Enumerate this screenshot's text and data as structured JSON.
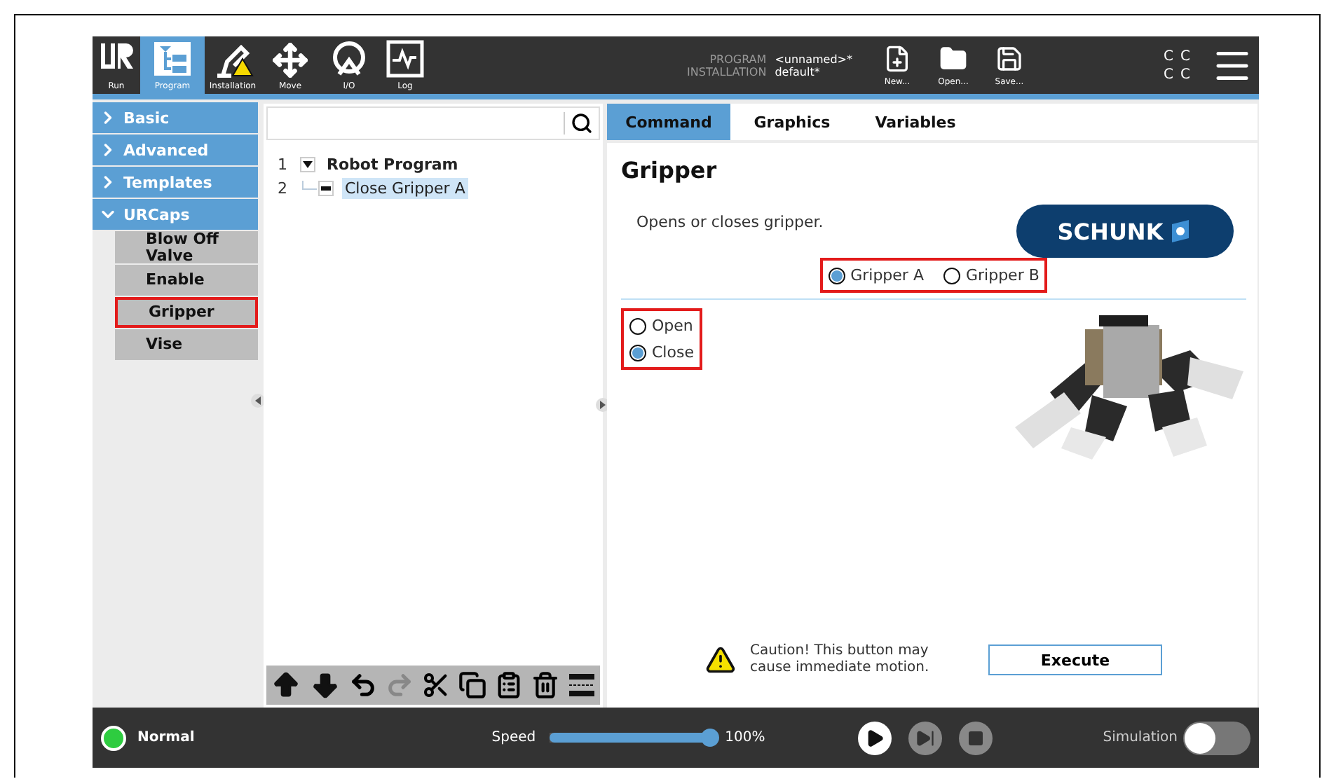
{
  "header": {
    "tabs": [
      {
        "label": "Run",
        "kind": "run",
        "selected": false
      },
      {
        "label": "Program",
        "kind": "program",
        "selected": true
      },
      {
        "label": "Installation",
        "kind": "installation",
        "selected": false
      },
      {
        "label": "Move",
        "kind": "move",
        "selected": false
      },
      {
        "label": "I/O",
        "kind": "io",
        "selected": false
      },
      {
        "label": "Log",
        "kind": "log",
        "selected": false
      }
    ],
    "program_label": "PROGRAM",
    "program_name": "<unnamed>*",
    "installation_label": "INSTALLATION",
    "installation_name": "default*",
    "file_buttons": [
      {
        "label": "New...",
        "kind": "new"
      },
      {
        "label": "Open...",
        "kind": "open"
      },
      {
        "label": "Save...",
        "kind": "save"
      }
    ],
    "status_letters": [
      "C",
      "C",
      "C",
      "C"
    ]
  },
  "sidebar": {
    "groups": [
      {
        "label": "Basic",
        "expanded": false
      },
      {
        "label": "Advanced",
        "expanded": false
      },
      {
        "label": "Templates",
        "expanded": false
      },
      {
        "label": "URCaps",
        "expanded": true,
        "children": [
          {
            "label": "Blow Off Valve",
            "selected": false,
            "highlighted": false
          },
          {
            "label": "Enable",
            "selected": false,
            "highlighted": false
          },
          {
            "label": "Gripper",
            "selected": false,
            "highlighted": true
          },
          {
            "label": "Vise",
            "selected": false,
            "highlighted": false
          }
        ]
      }
    ]
  },
  "tree": {
    "rows": [
      {
        "number": "1",
        "label": "Robot Program",
        "kind": "root",
        "expanded": true,
        "selected": false
      },
      {
        "number": "2",
        "label": "Close Gripper A",
        "kind": "node",
        "selected": true
      }
    ]
  },
  "tabs": [
    {
      "label": "Command",
      "selected": true
    },
    {
      "label": "Graphics",
      "selected": false
    },
    {
      "label": "Variables",
      "selected": false
    }
  ],
  "panel": {
    "title": "Gripper",
    "description": "Opens or closes gripper.",
    "logo": "SCHUNK",
    "gripper_options": {
      "highlighted": true,
      "items": [
        {
          "label": "Gripper A",
          "selected": true
        },
        {
          "label": "Gripper B",
          "selected": false
        }
      ]
    },
    "action_options": {
      "highlighted": true,
      "items": [
        {
          "label": "Open",
          "selected": false
        },
        {
          "label": "Close",
          "selected": true
        }
      ]
    },
    "caution": "Caution! This button may cause immediate motion.",
    "execute": "Execute"
  },
  "footer": {
    "status": "Normal",
    "speed_label": "Speed",
    "speed": {
      "level": 1.0
    },
    "speed_reading": "100%",
    "simulation_label": "Simulation",
    "simulation_on": false
  }
}
